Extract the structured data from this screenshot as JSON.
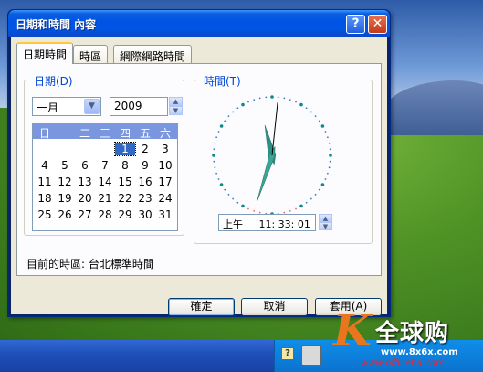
{
  "window": {
    "title": "日期和時間 內容",
    "help_glyph": "?",
    "close_glyph": "✕"
  },
  "tabs": [
    {
      "label": "日期時間",
      "active": true
    },
    {
      "label": "時區",
      "active": false
    },
    {
      "label": "網際網路時間",
      "active": false
    }
  ],
  "date_group": {
    "legend": "日期(D)",
    "month_value": "一月",
    "year_value": "2009",
    "weekdays": [
      "日",
      "一",
      "二",
      "三",
      "四",
      "五",
      "六"
    ],
    "weeks": [
      [
        "",
        "",
        "",
        "",
        "1",
        "2",
        "3"
      ],
      [
        "4",
        "5",
        "6",
        "7",
        "8",
        "9",
        "10"
      ],
      [
        "11",
        "12",
        "13",
        "14",
        "15",
        "16",
        "17"
      ],
      [
        "18",
        "19",
        "20",
        "21",
        "22",
        "23",
        "24"
      ],
      [
        "25",
        "26",
        "27",
        "28",
        "29",
        "30",
        "31"
      ]
    ],
    "selected_day": "1"
  },
  "time_group": {
    "legend": "時間(T)",
    "time_value": "上午     11: 33: 01",
    "clock": {
      "hour": 11,
      "minute": 33,
      "second": 1
    }
  },
  "timezone": {
    "text": "目前的時區: 台北標準時間"
  },
  "buttons": {
    "ok": "確定",
    "cancel": "取消",
    "apply": "套用(A)"
  },
  "taskbar": {
    "tray_icon_glyph": "?"
  },
  "watermark": {
    "logo_letter": "K",
    "brand": "全球购",
    "url": "www.8x6x.com",
    "url2": "www.officeba.com"
  },
  "colors": {
    "titlebar": "#0054e3",
    "tab_highlight": "#ffc83c",
    "calendar_header": "#7a96df",
    "selection": "#316ac5"
  }
}
